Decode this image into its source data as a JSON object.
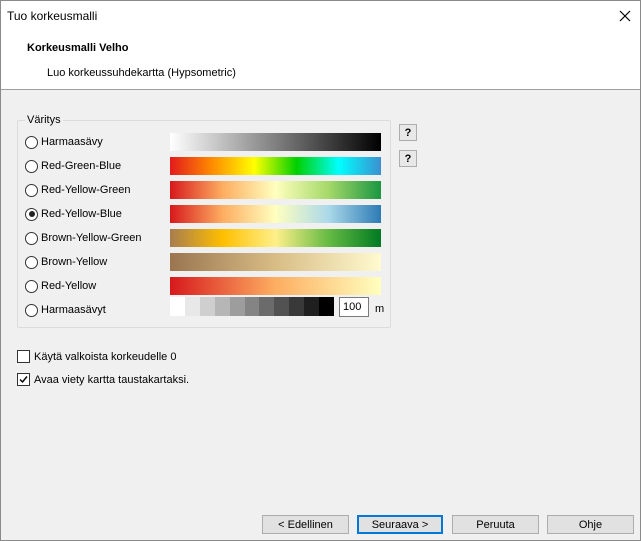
{
  "window": {
    "title": "Tuo korkeusmalli"
  },
  "header": {
    "title": "Korkeusmalli Velho",
    "subtitle": "Luo korkeussuhdekartta (Hypsometric)"
  },
  "coloring": {
    "group_label": "Väritys",
    "selected_index": 3,
    "options": [
      {
        "label": "Harmaasävy",
        "ramp": [
          "#ffffff",
          "#000000"
        ]
      },
      {
        "label": "Red-Green-Blue",
        "ramp": [
          "#e31a1c",
          "#ff8c00",
          "#ffff00",
          "#00d000",
          "#00ffff",
          "#3b8fd0"
        ]
      },
      {
        "label": "Red-Yellow-Green",
        "ramp": [
          "#d7191c",
          "#fdae61",
          "#ffffbf",
          "#a6d96a",
          "#1a9641"
        ]
      },
      {
        "label": "Red-Yellow-Blue",
        "ramp": [
          "#d7191c",
          "#fdae61",
          "#ffffbf",
          "#abd9e9",
          "#2c7bb6"
        ]
      },
      {
        "label": "Brown-Yellow-Green",
        "ramp": [
          "#a87d4f",
          "#ffbf00",
          "#fff08a",
          "#66bb44",
          "#007a22"
        ]
      },
      {
        "label": "Brown-Yellow",
        "ramp": [
          "#9a7550",
          "#d8bd85",
          "#fffad0"
        ]
      },
      {
        "label": "Red-Yellow",
        "ramp": [
          "#d7191c",
          "#fdae61",
          "#ffffbf"
        ]
      },
      {
        "label": "Harmaasävyt",
        "steps": [
          "#ffffff",
          "#e8e8e8",
          "#cfcfcf",
          "#b6b6b6",
          "#9d9d9d",
          "#848484",
          "#6b6b6b",
          "#525252",
          "#393939",
          "#1f1f1f",
          "#000000"
        ]
      }
    ],
    "step_value": "100",
    "step_unit": "m",
    "help_label": "?"
  },
  "options": {
    "white_for_zero": {
      "label": "Käytä valkoista korkeudelle 0",
      "checked": false
    },
    "open_as_background": {
      "label": "Avaa viety kartta taustakartaksi.",
      "checked": true
    }
  },
  "buttons": {
    "back": "< Edellinen",
    "next": "Seuraava >",
    "cancel": "Peruuta",
    "help": "Ohje"
  },
  "icons": {
    "close": "close-icon",
    "checkmark": "checkmark-icon"
  }
}
